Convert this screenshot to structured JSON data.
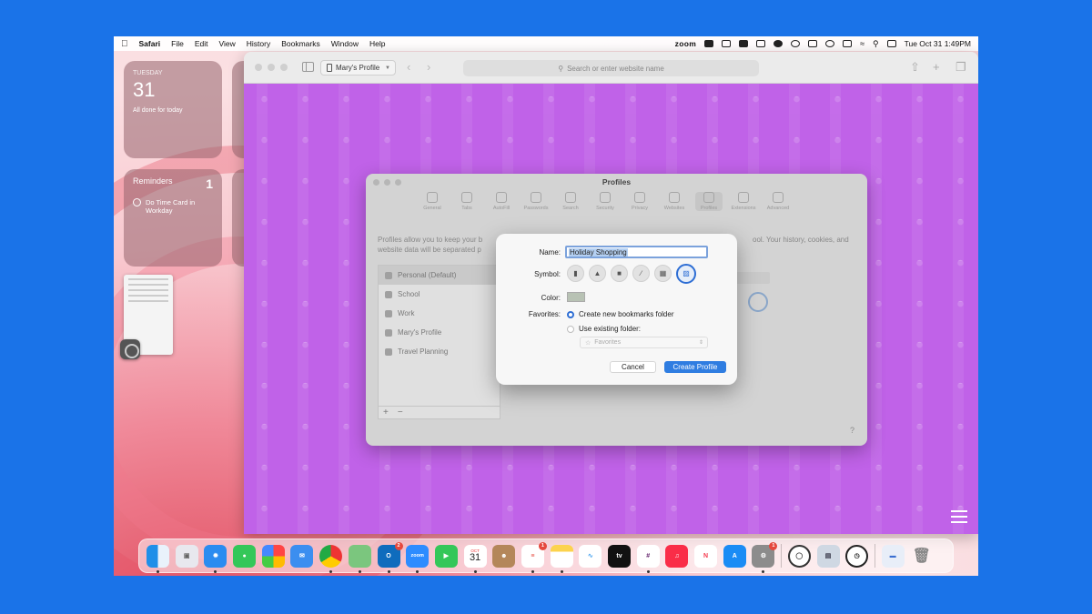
{
  "menubar": {
    "app_name": "Safari",
    "items": [
      "File",
      "Edit",
      "View",
      "History",
      "Bookmarks",
      "Window",
      "Help"
    ],
    "status_zoom": "zoom",
    "datetime": "Tue Oct 31  1:49PM"
  },
  "widgets": {
    "calendar": {
      "day": "TUESDAY",
      "date": "31",
      "note": "All done for today"
    },
    "reminders": {
      "title": "Reminders",
      "count": "1",
      "item": "Do Time Card in Workday"
    }
  },
  "safari": {
    "profile_label": "Mary's Profile",
    "search_placeholder": "Search or enter website name"
  },
  "settings": {
    "title": "Profiles",
    "tabs": [
      "General",
      "Tabs",
      "AutoFill",
      "Passwords",
      "Search",
      "Security",
      "Privacy",
      "Websites",
      "Profiles",
      "Extensions",
      "Advanced"
    ],
    "description_left": "Profiles allow you to keep your b",
    "description_right": "ool. Your history, cookies, and",
    "description_line2": "website data will be separated p",
    "profiles": [
      "Personal (Default)",
      "School",
      "Work",
      "Mary's Profile",
      "Travel Planning"
    ],
    "add_label": "+",
    "remove_label": "−",
    "help_label": "?"
  },
  "dialog": {
    "name_label": "Name:",
    "name_value": "Holiday Shopping",
    "symbol_label": "Symbol:",
    "color_label": "Color:",
    "favorites_label": "Favorites:",
    "option_new": "Create new bookmarks folder",
    "option_existing": "Use existing folder:",
    "existing_placeholder": "Favorites",
    "cancel_label": "Cancel",
    "create_label": "Create Profile",
    "color_value": "#b8c2b4"
  },
  "dock": {
    "calendar_month": "OCT",
    "calendar_day": "31",
    "zoom_label": "zoom",
    "outlook_badge": "2",
    "reminders_badge": "1",
    "settings_badge": "1"
  },
  "colors": {
    "backdrop": "#1a73e8",
    "safari_page": "#c062e8",
    "accent": "#2f7de1"
  }
}
